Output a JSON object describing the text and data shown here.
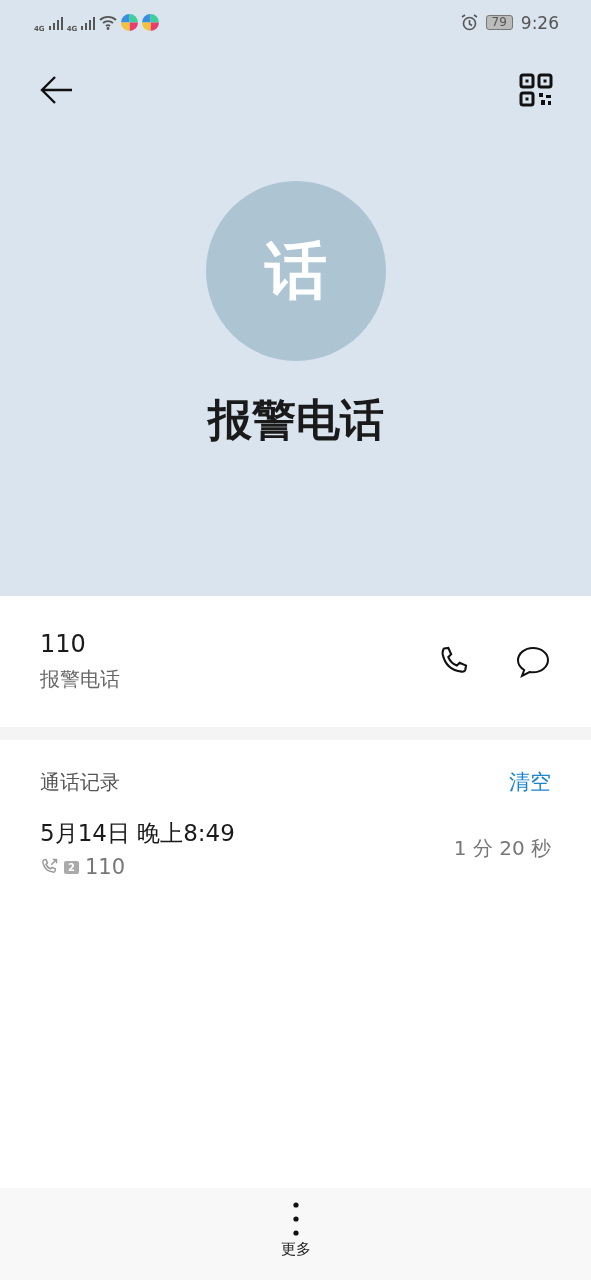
{
  "status_bar": {
    "network_1": "4G",
    "network_2": "4G",
    "battery": "79",
    "time": "9:26"
  },
  "contact": {
    "avatar_letter": "话",
    "name": "报警电话"
  },
  "number": {
    "value": "110",
    "label": "报警电话"
  },
  "call_log": {
    "title": "通话记录",
    "clear": "清空",
    "entries": [
      {
        "time": "5月14日 晚上8:49",
        "sim": "2",
        "number": "110",
        "duration": "1 分 20 秒"
      }
    ]
  },
  "bottom_bar": {
    "more": "更多"
  }
}
